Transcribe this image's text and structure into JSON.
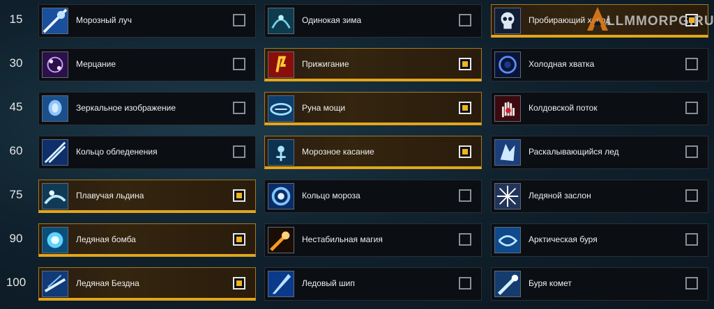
{
  "watermark": {
    "text": "LLMMORPG.RU",
    "icon": "a-logo-icon"
  },
  "colors": {
    "selected_accent": "#e2a61c",
    "check_fill": "#f1b31c"
  },
  "rows": [
    {
      "level": "15",
      "talents": [
        {
          "name": "Морозный луч",
          "selected": false,
          "icon": "frost-ray-icon"
        },
        {
          "name": "Одинокая зима",
          "selected": false,
          "icon": "lonely-winter-icon"
        },
        {
          "name": "Пробирающий холод",
          "selected": true,
          "icon": "skull-icon"
        }
      ]
    },
    {
      "level": "30",
      "talents": [
        {
          "name": "Мерцание",
          "selected": false,
          "icon": "shimmer-icon"
        },
        {
          "name": "Прижигание",
          "selected": true,
          "icon": "cauterize-icon"
        },
        {
          "name": "Холодная хватка",
          "selected": false,
          "icon": "cold-grip-icon"
        }
      ]
    },
    {
      "level": "45",
      "talents": [
        {
          "name": "Зеркальное изображение",
          "selected": false,
          "icon": "mirror-image-icon"
        },
        {
          "name": "Руна мощи",
          "selected": true,
          "icon": "rune-of-power-icon"
        },
        {
          "name": "Колдовской поток",
          "selected": false,
          "icon": "hand-icon"
        }
      ]
    },
    {
      "level": "60",
      "talents": [
        {
          "name": "Кольцо обледенения",
          "selected": false,
          "icon": "ice-ring-icon"
        },
        {
          "name": "Морозное касание",
          "selected": true,
          "icon": "frost-touch-icon"
        },
        {
          "name": "Раскалывающийся лед",
          "selected": false,
          "icon": "shatter-ice-icon"
        }
      ]
    },
    {
      "level": "75",
      "talents": [
        {
          "name": "Плавучая льдина",
          "selected": true,
          "icon": "ice-floe-icon"
        },
        {
          "name": "Кольцо мороза",
          "selected": false,
          "icon": "frost-ring-icon"
        },
        {
          "name": "Ледяной заслон",
          "selected": false,
          "icon": "ice-barrier-icon"
        }
      ]
    },
    {
      "level": "90",
      "talents": [
        {
          "name": "Ледяная бомба",
          "selected": true,
          "icon": "frost-bomb-icon"
        },
        {
          "name": "Нестабильная магия",
          "selected": false,
          "icon": "unstable-magic-icon"
        },
        {
          "name": "Арктическая буря",
          "selected": false,
          "icon": "arctic-storm-icon"
        }
      ]
    },
    {
      "level": "100",
      "talents": [
        {
          "name": "Ледяная Бездна",
          "selected": true,
          "icon": "ice-abyss-icon"
        },
        {
          "name": "Ледовый шип",
          "selected": false,
          "icon": "ice-spike-icon"
        },
        {
          "name": "Буря комет",
          "selected": false,
          "icon": "comet-storm-icon"
        }
      ]
    }
  ]
}
